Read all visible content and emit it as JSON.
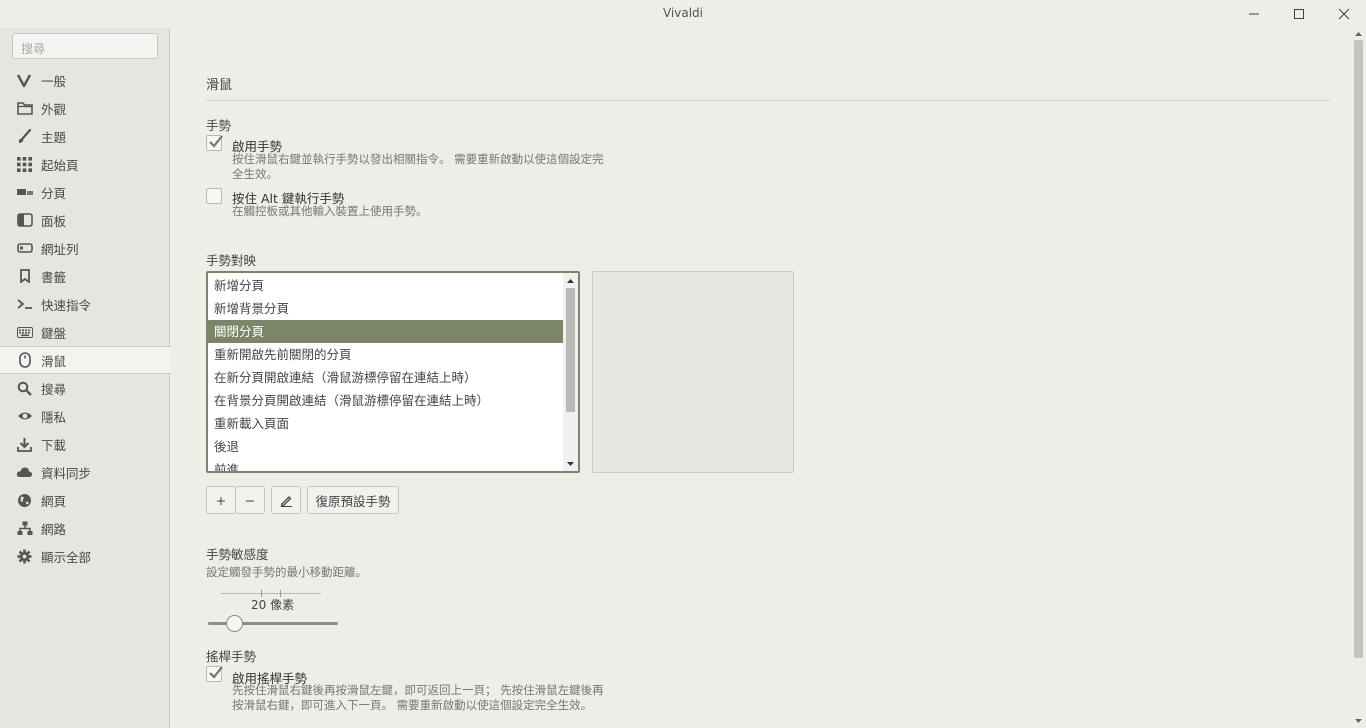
{
  "window": {
    "title": "Vivaldi"
  },
  "sidebar": {
    "search_placeholder": "搜尋",
    "items": [
      {
        "label": "一般",
        "icon": "vivaldi-logo-icon"
      },
      {
        "label": "外觀",
        "icon": "folder-icon"
      },
      {
        "label": "主題",
        "icon": "brush-icon"
      },
      {
        "label": "起始頁",
        "icon": "grid-icon"
      },
      {
        "label": "分頁",
        "icon": "tabs-icon"
      },
      {
        "label": "面板",
        "icon": "panel-icon"
      },
      {
        "label": "網址列",
        "icon": "address-bar-icon"
      },
      {
        "label": "書籤",
        "icon": "bookmark-icon"
      },
      {
        "label": "快速指令",
        "icon": "command-icon"
      },
      {
        "label": "鍵盤",
        "icon": "keyboard-icon"
      },
      {
        "label": "滑鼠",
        "icon": "mouse-icon",
        "active": true
      },
      {
        "label": "搜尋",
        "icon": "search-icon"
      },
      {
        "label": "隱私",
        "icon": "eye-icon"
      },
      {
        "label": "下載",
        "icon": "download-icon"
      },
      {
        "label": "資料同步",
        "icon": "cloud-icon"
      },
      {
        "label": "網頁",
        "icon": "globe-icon"
      },
      {
        "label": "網路",
        "icon": "network-icon"
      },
      {
        "label": "顯示全部",
        "icon": "gear-icon"
      }
    ]
  },
  "main": {
    "title": "滑鼠",
    "gestures": {
      "heading": "手勢",
      "enable_label": "啟用手勢",
      "enable_checked": true,
      "enable_hint_1": "按住滑鼠右鍵並執行手勢以發出相關指令。 需要重新啟動以使這個設定完",
      "enable_hint_2": "全生效。",
      "alt_label": "按住 Alt 鍵執行手勢",
      "alt_checked": false,
      "alt_hint": "在觸控板或其他輸入裝置上使用手勢。"
    },
    "mapping": {
      "heading": "手勢對映",
      "items": [
        "新增分頁",
        "新增背景分頁",
        "關閉分頁",
        "重新開啟先前關閉的分頁",
        "在新分頁開啟連結（滑鼠游標停留在連結上時）",
        "在背景分頁開啟連結（滑鼠游標停留在連結上時）",
        "重新載入頁面",
        "後退",
        "前進"
      ],
      "selected": "關閉分頁",
      "add_label": "+",
      "remove_label": "−",
      "reset_label": "復原預設手勢"
    },
    "sensitivity": {
      "heading": "手勢敏感度",
      "hint": "設定觸發手勢的最小移動距離。",
      "value_label": "20 像素",
      "value": 20
    },
    "rocker": {
      "heading": "搖桿手勢",
      "enable_label": "啟用搖桿手勢",
      "enable_checked": true,
      "hint_1": "先按住滑鼠右鍵後再按滑鼠左鍵，即可返回上一頁； 先按住滑鼠左鍵後再",
      "hint_2": "按滑鼠右鍵，即可進入下一頁。 需要重新啟動以使這個設定完全生效。"
    }
  }
}
